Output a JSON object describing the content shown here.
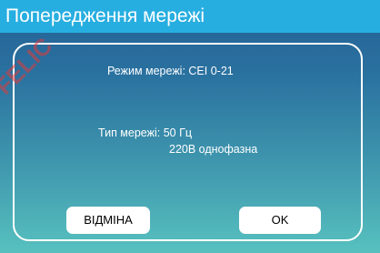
{
  "dialog": {
    "title": "Попередження мережі",
    "mode_line": "Режим мережі: CEI 0-21",
    "type_line": "Тип мережі: 50 Гц",
    "phase_line": "220В однофазна"
  },
  "buttons": {
    "cancel_label": "ВІДМІНА",
    "ok_label": "OK"
  },
  "watermark": {
    "text": "FELIC"
  },
  "colors": {
    "title_bar": "#27aee0",
    "gradient_top": "#245f95",
    "gradient_bottom": "#57c1bf",
    "watermark": "#e23a3a"
  }
}
